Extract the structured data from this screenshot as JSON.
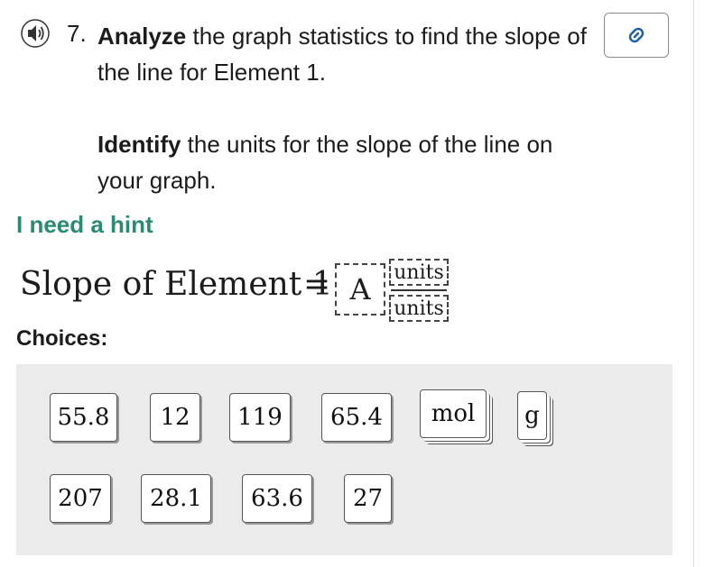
{
  "question": {
    "number": "7.",
    "bold_lead": "Analyze",
    "text_rest": " the graph statistics to find the slope of the line for Element 1.",
    "sub_bold": "Identify",
    "sub_rest": " the units for the slope of the line on your graph."
  },
  "hint_label": "I need a hint",
  "equation": {
    "lhs": "Slope of Element 1",
    "equals": "=",
    "box_value": "A",
    "numerator_unit": "units",
    "denominator_unit": "units"
  },
  "choices_label": "Choices:",
  "choices_row1": [
    "55.8",
    "12",
    "119",
    "65.4",
    "mol",
    "g"
  ],
  "choices_row2": [
    "207",
    "28.1",
    "63.6",
    "27"
  ],
  "icons": {
    "audio": "speaker-icon",
    "link": "link-icon"
  },
  "colors": {
    "hint": "#2a8a72",
    "tray": "#ebebeb"
  }
}
